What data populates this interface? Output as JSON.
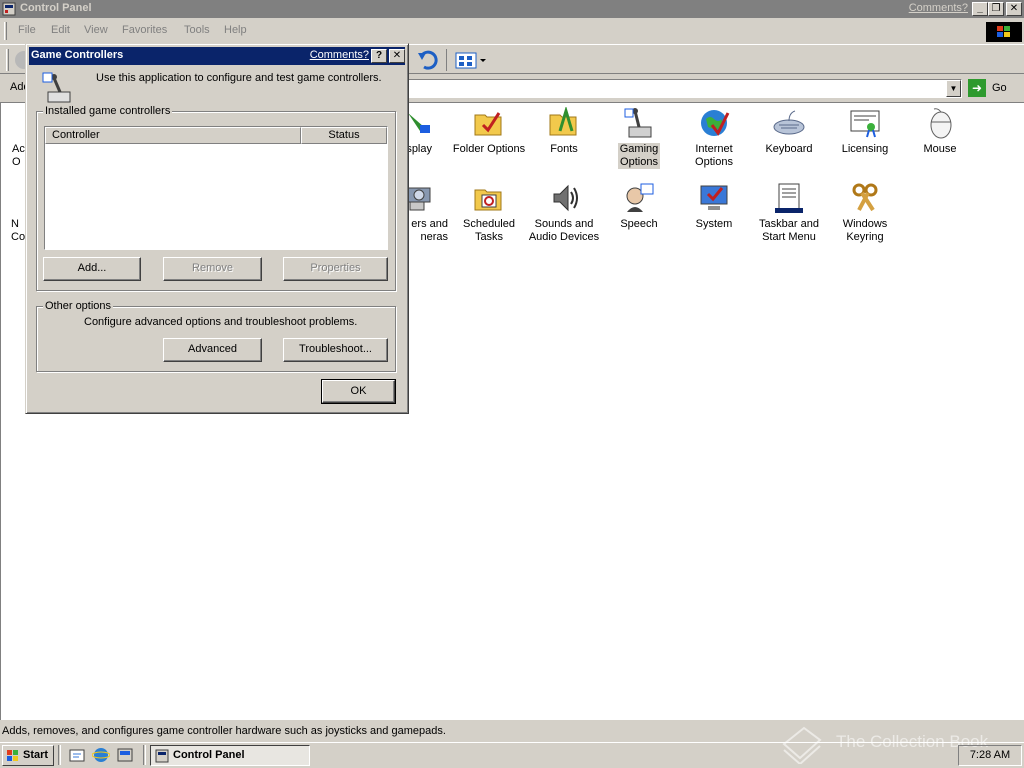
{
  "window": {
    "title": "Control Panel",
    "comments_link": "Comments?"
  },
  "menu": [
    "File",
    "Edit",
    "View",
    "Favorites",
    "Tools",
    "Help"
  ],
  "address": {
    "label": "Add",
    "go_label": "Go"
  },
  "icons": [
    {
      "name": "acc",
      "label": "Acc\nO"
    },
    {
      "name": "display",
      "label": "splay"
    },
    {
      "name": "folder-options",
      "label": "Folder Options"
    },
    {
      "name": "fonts",
      "label": "Fonts"
    },
    {
      "name": "gaming-options",
      "label": "Gaming\nOptions"
    },
    {
      "name": "internet-options",
      "label": "Internet\nOptions"
    },
    {
      "name": "keyboard",
      "label": "Keyboard"
    },
    {
      "name": "licensing",
      "label": "Licensing"
    },
    {
      "name": "mouse",
      "label": "Mouse"
    },
    {
      "name": "network",
      "label": "N\nCon"
    },
    {
      "name": "scanners",
      "label": "ers and\nneras"
    },
    {
      "name": "scheduled-tasks",
      "label": "Scheduled\nTasks"
    },
    {
      "name": "sounds",
      "label": "Sounds and\nAudio Devices"
    },
    {
      "name": "speech",
      "label": "Speech"
    },
    {
      "name": "system",
      "label": "System"
    },
    {
      "name": "taskbar",
      "label": "Taskbar and\nStart Menu"
    },
    {
      "name": "windows-keyring",
      "label": "Windows\nKeyring"
    }
  ],
  "statusbar": {
    "text": "Adds, removes, and configures game controller hardware such as joysticks and gamepads."
  },
  "watermark": "The Collection Book",
  "taskbar": {
    "start_label": "Start",
    "task_label": "Control Panel",
    "clock": "7:28 AM"
  },
  "dialog": {
    "title": "Game Controllers",
    "comments_link": "Comments?",
    "description": "Use this application to configure and test game controllers.",
    "installed_group": "Installed game controllers",
    "columns": [
      "Controller",
      "Status"
    ],
    "add_button": "Add...",
    "remove_button": "Remove",
    "properties_button": "Properties",
    "other_group": "Other options",
    "other_description": "Configure advanced options and troubleshoot problems.",
    "advanced_button": "Advanced",
    "troubleshoot_button": "Troubleshoot...",
    "ok_button": "OK"
  }
}
